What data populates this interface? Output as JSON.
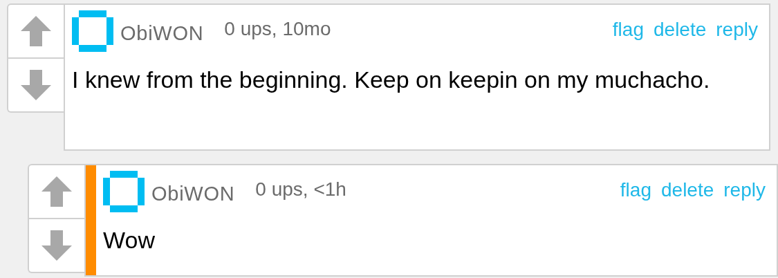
{
  "comments": [
    {
      "username": "ObiWON",
      "meta": "0 ups, 10mo",
      "actions": [
        "flag",
        "delete",
        "reply"
      ],
      "text": "I knew from the beginning. Keep on keepin on my muchacho.",
      "highlighted": false,
      "reply": false
    },
    {
      "username": "ObiWON",
      "meta": "0 ups, <1h",
      "actions": [
        "flag",
        "delete",
        "reply"
      ],
      "text": "Wow",
      "highlighted": true,
      "reply": true
    }
  ]
}
